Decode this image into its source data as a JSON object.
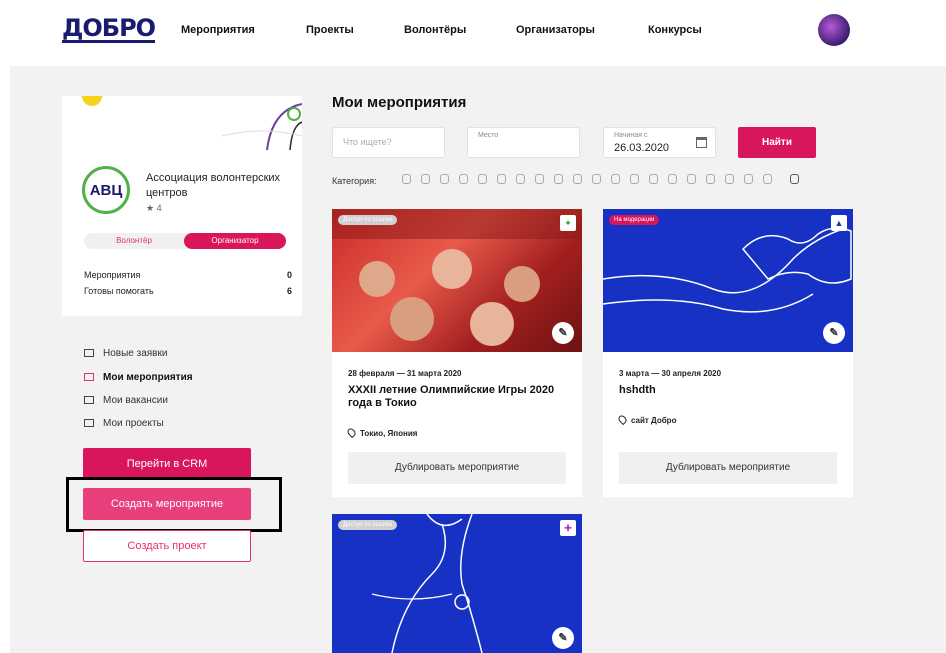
{
  "header": {
    "logo": "ДОБРО",
    "nav": [
      "Мероприятия",
      "Проекты",
      "Волонтёры",
      "Организаторы",
      "Конкурсы"
    ]
  },
  "profile": {
    "logo_text": "АВЦ",
    "org_name": "Ассоциация волонтерских центров",
    "rating": "4",
    "toggle_volunteer": "Волонтёр",
    "toggle_organizer": "Организатор",
    "stats": [
      {
        "label": "Мероприятия",
        "value": "0"
      },
      {
        "label": "Готовы помогать",
        "value": "6"
      }
    ]
  },
  "menu": [
    {
      "label": "Новые заявки",
      "active": false
    },
    {
      "label": "Мои мероприятия",
      "active": true
    },
    {
      "label": "Мои вакансии",
      "active": false
    },
    {
      "label": "Мои проекты",
      "active": false
    }
  ],
  "buttons": {
    "crm": "Перейти в CRM",
    "create_event": "Создать мероприятие",
    "create_project": "Создать проект"
  },
  "main": {
    "title": "Мои мероприятия",
    "search_placeholder": "Что ищете?",
    "place_label": "Место",
    "date_label": "Начиная с",
    "date_value": "26.03.2020",
    "find_button": "Найти",
    "category_label": "Категория:"
  },
  "cards": [
    {
      "badge": "Доступ по ссылке",
      "date": "28 февраля — 31 марта 2020",
      "title": "XXXII летние Олимпийские Игры 2020 года в Токио",
      "location": "Токио, Япония",
      "duplicate": "Дублировать мероприятие"
    },
    {
      "badge": "На модерации",
      "date": "3 марта — 30 апреля 2020",
      "title": "hshdth",
      "location": "сайт Добро",
      "duplicate": "Дублировать мероприятие"
    },
    {
      "badge": "Доступ по ссылке"
    }
  ],
  "colors": {
    "accent": "#d9155c",
    "brand": "#1a1a6e",
    "card_blue": "#1631c4"
  }
}
